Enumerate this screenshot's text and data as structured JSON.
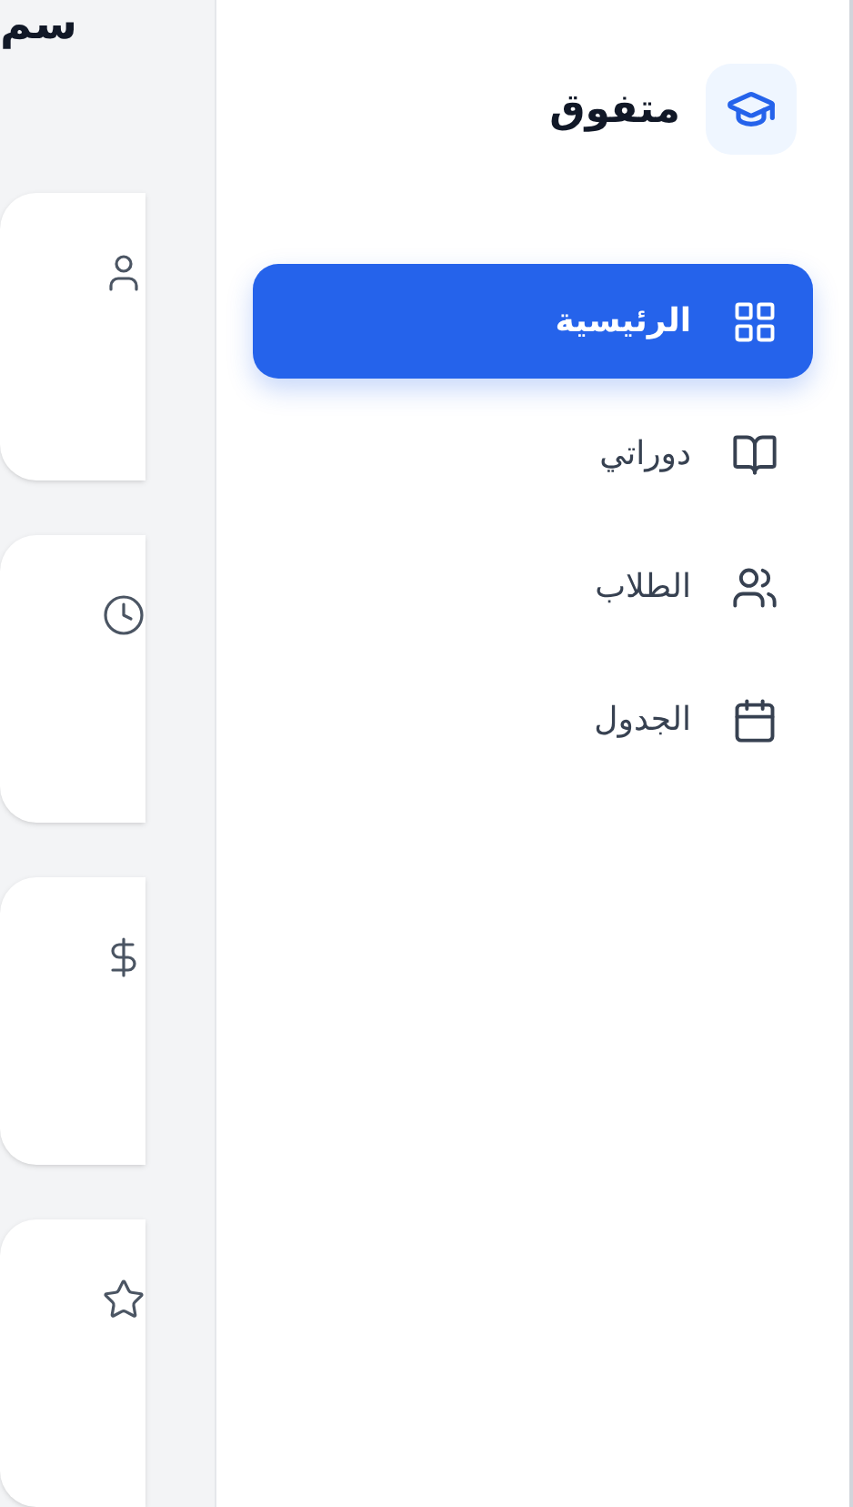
{
  "page": {
    "heading": "سم"
  },
  "sidebar": {
    "brand": "متفوق",
    "items": [
      {
        "label": "الرئيسية",
        "selected": true
      },
      {
        "label": "دوراتي",
        "selected": false
      },
      {
        "label": "الطلاب",
        "selected": false
      },
      {
        "label": "الجدول",
        "selected": false
      }
    ]
  }
}
